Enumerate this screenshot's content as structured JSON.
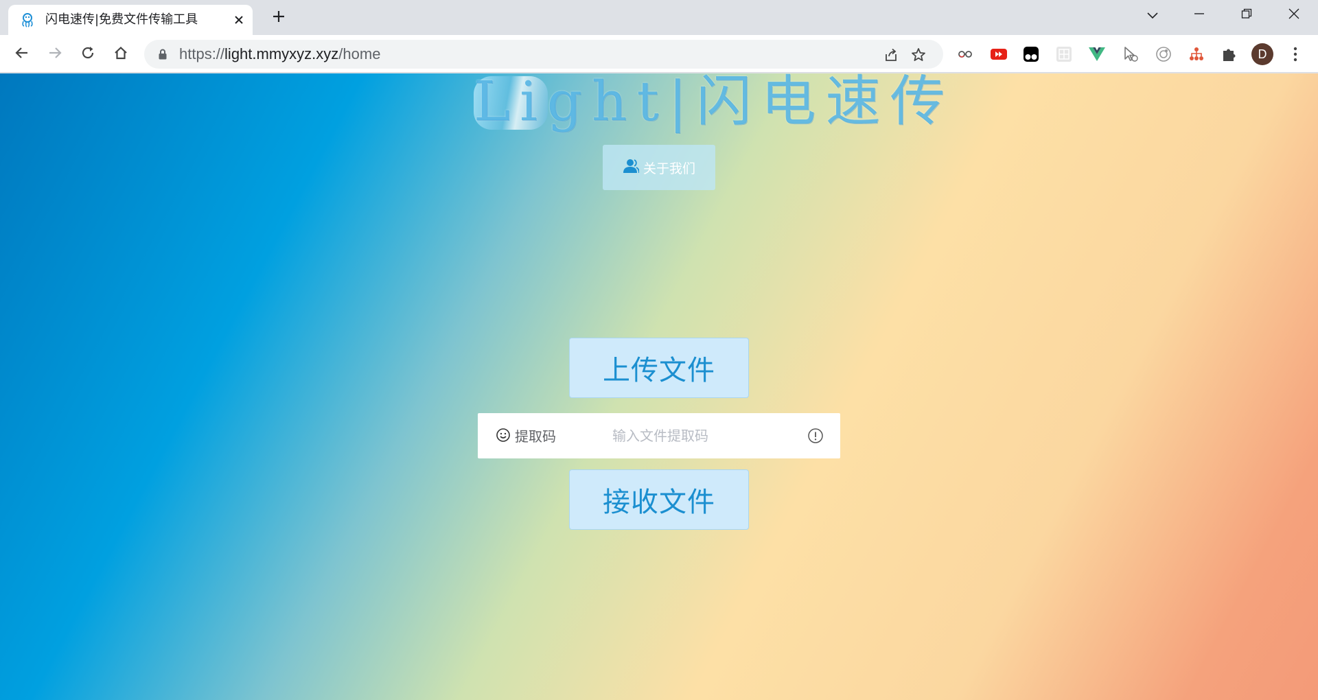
{
  "browser": {
    "tab": {
      "title": "闪电速传|免费文件传输工具",
      "favicon": "octopus-icon",
      "close": "close-icon"
    },
    "new_tab": "plus-icon",
    "window_controls": [
      "chevron-down-icon",
      "minimize-icon",
      "restore-icon",
      "close-icon"
    ],
    "nav": [
      "back-arrow-icon",
      "forward-arrow-icon",
      "reload-icon",
      "home-icon"
    ],
    "url": {
      "scheme": "https://",
      "host": "light.mmyxyz.xyz",
      "path": "/home"
    },
    "omnibox_icons": [
      "share-icon",
      "star-icon"
    ],
    "extensions": [
      "glasses-icon",
      "youtube-icon",
      "tampermonkey-icon",
      "grid-icon",
      "vue-icon",
      "cursor-icon",
      "circle-icon",
      "tree-icon",
      "puzzle-icon"
    ],
    "avatar_letter": "D",
    "menu": "kebab-menu-icon"
  },
  "page": {
    "logo_text": "Light|闪电速传",
    "about_button": {
      "icon": "user-icon",
      "label": "关于我们"
    },
    "upload_button": "上传文件",
    "code_field": {
      "icon": "smile-icon",
      "label": "提取码",
      "placeholder": "输入文件提取码",
      "value": "",
      "suffix_icon": "info-circle-icon"
    },
    "receive_button": "接收文件"
  },
  "colors": {
    "accent": "#1b8fd0",
    "button_bg": "#cfeafb",
    "gradient_start": "#0078be",
    "gradient_end": "#f49a78"
  }
}
